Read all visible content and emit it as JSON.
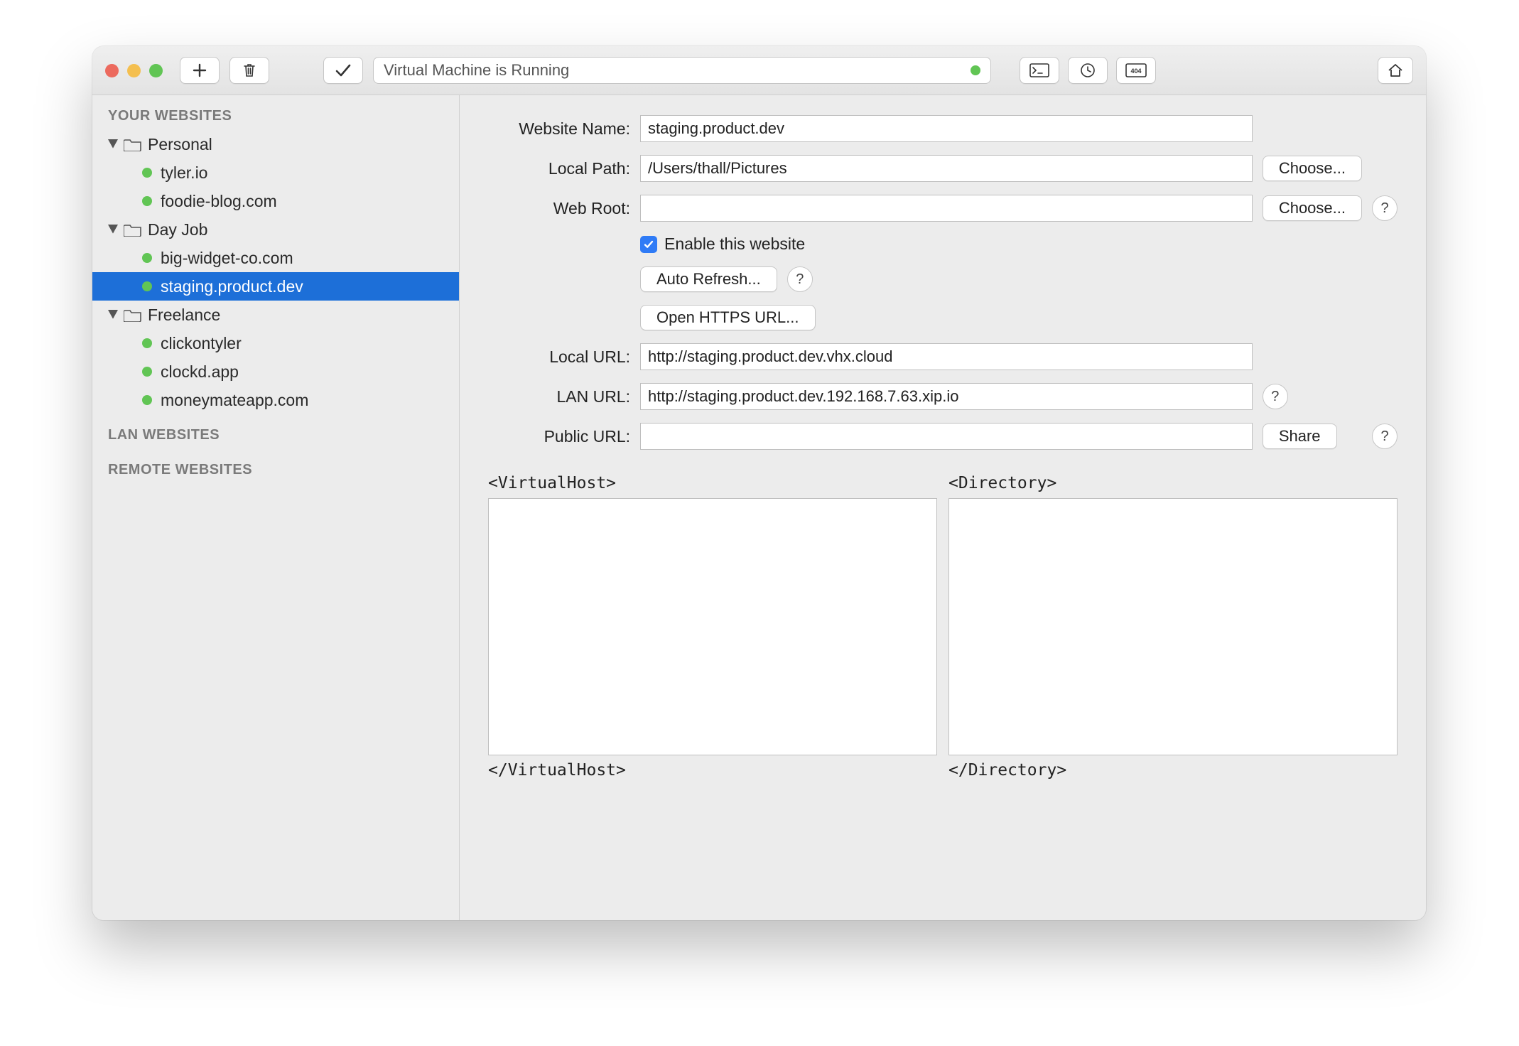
{
  "toolbar": {
    "status_text": "Virtual Machine is Running"
  },
  "sidebar": {
    "section_your": "YOUR WEBSITES",
    "section_lan": "LAN WEBSITES",
    "section_remote": "REMOTE WEBSITES",
    "folders": [
      {
        "name": "Personal",
        "sites": [
          "tyler.io",
          "foodie-blog.com"
        ]
      },
      {
        "name": "Day Job",
        "sites": [
          "big-widget-co.com",
          "staging.product.dev"
        ]
      },
      {
        "name": "Freelance",
        "sites": [
          "clickontyler",
          "clockd.app",
          "moneymateapp.com"
        ]
      }
    ],
    "selected": "staging.product.dev"
  },
  "form": {
    "labels": {
      "website_name": "Website Name:",
      "local_path": "Local Path:",
      "web_root": "Web Root:",
      "local_url": "Local URL:",
      "lan_url": "LAN URL:",
      "public_url": "Public URL:"
    },
    "values": {
      "website_name": "staging.product.dev",
      "local_path": "/Users/thall/Pictures",
      "web_root": "",
      "local_url": "http://staging.product.dev.vhx.cloud",
      "lan_url": "http://staging.product.dev.192.168.7.63.xip.io",
      "public_url": ""
    },
    "enable_label": "Enable this website",
    "enable_checked": true,
    "buttons": {
      "choose": "Choose...",
      "auto_refresh": "Auto Refresh...",
      "open_https": "Open HTTPS URL...",
      "share": "Share",
      "help": "?"
    },
    "virtualhost_open": "<VirtualHost>",
    "virtualhost_close": "</VirtualHost>",
    "directory_open": "<Directory>",
    "directory_close": "</Directory>"
  }
}
